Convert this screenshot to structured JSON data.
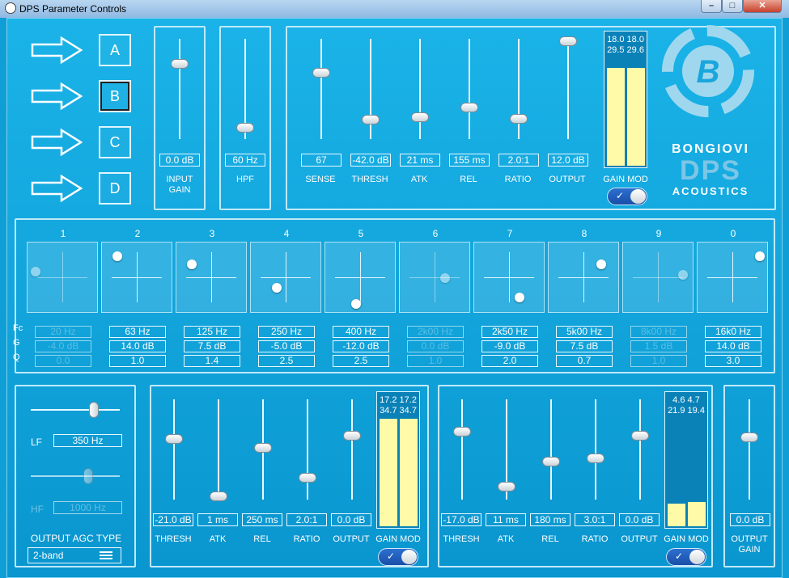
{
  "window": {
    "title": "DPS Parameter Controls"
  },
  "presets": [
    "A",
    "B",
    "C",
    "D"
  ],
  "selected_preset": "B",
  "input": {
    "gain": {
      "value": "0.0 dB",
      "label_line1": "INPUT",
      "label_line2": "GAIN"
    },
    "hpf": {
      "value": "60 Hz",
      "label": "HPF"
    }
  },
  "compressor": {
    "sense": {
      "value": "67",
      "label": "SENSE"
    },
    "thresh": {
      "value": "-42.0 dB",
      "label": "THRESH"
    },
    "atk": {
      "value": "21 ms",
      "label": "ATK"
    },
    "rel": {
      "value": "155 ms",
      "label": "REL"
    },
    "ratio": {
      "value": "2.0:1",
      "label": "RATIO"
    },
    "output": {
      "value": "12.0 dB",
      "label": "OUTPUT"
    },
    "meter_line1": "18.0 18.0",
    "meter_line2": "29.5 29.6",
    "meter_levels": [
      0.73,
      0.73
    ],
    "gain_mod_label": "GAIN MOD",
    "gain_mod_on": true
  },
  "logo": {
    "line1": "BONGIOVI",
    "line2": "DPS",
    "line3": "ACOUSTICS"
  },
  "eq": {
    "row_labels": {
      "fc": "Fc",
      "g": "G",
      "q": "Q"
    },
    "bands": [
      {
        "num": "1",
        "fc": "20 Hz",
        "g": "-4.0 dB",
        "q": "0.0",
        "enabled": false
      },
      {
        "num": "2",
        "fc": "63 Hz",
        "g": "14.0 dB",
        "q": "1.0",
        "enabled": true
      },
      {
        "num": "3",
        "fc": "125 Hz",
        "g": "7.5 dB",
        "q": "1.4",
        "enabled": true
      },
      {
        "num": "4",
        "fc": "250 Hz",
        "g": "-5.0 dB",
        "q": "2.5",
        "enabled": true
      },
      {
        "num": "5",
        "fc": "400 Hz",
        "g": "-12.0 dB",
        "q": "2.5",
        "enabled": true
      },
      {
        "num": "6",
        "fc": "2k00 Hz",
        "g": "0.0 dB",
        "q": "1.0",
        "enabled": false
      },
      {
        "num": "7",
        "fc": "2k50 Hz",
        "g": "-9.0 dB",
        "q": "2.0",
        "enabled": true
      },
      {
        "num": "8",
        "fc": "5k00 Hz",
        "g": "7.5 dB",
        "q": "0.7",
        "enabled": true
      },
      {
        "num": "9",
        "fc": "8k00 Hz",
        "g": "1.5 dB",
        "q": "1.0",
        "enabled": false
      },
      {
        "num": "0",
        "fc": "16k0 Hz",
        "g": "14.0 dB",
        "q": "3.0",
        "enabled": true
      }
    ]
  },
  "output_agc": {
    "lf_label": "LF",
    "lf_value": "350 Hz",
    "hf_label": "HF",
    "hf_value": "1000 Hz",
    "type_label": "OUTPUT AGC TYPE",
    "type_value": "2-band"
  },
  "lf_comp": {
    "thresh": {
      "value": "-21.0 dB",
      "label": "THRESH"
    },
    "atk": {
      "value": "1 ms",
      "label": "ATK"
    },
    "rel": {
      "value": "250 ms",
      "label": "REL"
    },
    "ratio": {
      "value": "2.0:1",
      "label": "RATIO"
    },
    "output": {
      "value": "0.0 dB",
      "label": "OUTPUT"
    },
    "meter_line1": "17.2 17.2",
    "meter_line2": "34.7 34.7",
    "meter_levels": [
      0.8,
      0.8
    ],
    "gain_mod_label": "GAIN MOD",
    "gain_mod_on": true
  },
  "hf_comp": {
    "thresh": {
      "value": "-17.0 dB",
      "label": "THRESH"
    },
    "atk": {
      "value": "11 ms",
      "label": "ATK"
    },
    "rel": {
      "value": "180 ms",
      "label": "REL"
    },
    "ratio": {
      "value": "3.0:1",
      "label": "RATIO"
    },
    "output": {
      "value": "0.0 dB",
      "label": "OUTPUT"
    },
    "meter_line1": "4.6   4.7",
    "meter_line2": "21.9 19.4",
    "meter_levels": [
      0.17,
      0.18
    ],
    "gain_mod_label": "GAIN MOD",
    "gain_mod_on": true
  },
  "output_gain": {
    "value": "0.0 dB",
    "label_line1": "OUTPUT",
    "label_line2": "GAIN"
  }
}
